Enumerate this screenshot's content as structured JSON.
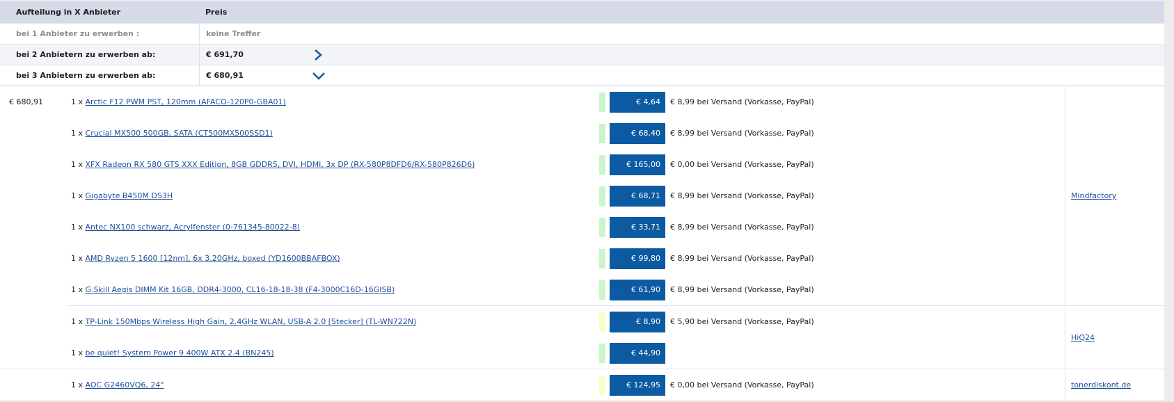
{
  "split": {
    "header": {
      "option": "Aufteilung in X Anbieter",
      "price": "Preis"
    },
    "rows": [
      {
        "label": "bei 1 Anbieter zu erwerben :",
        "price": "keine Treffer"
      },
      {
        "label": "bei 2 Anbietern zu erwerben ab:",
        "price": "€ 691,70",
        "toggle_icon": "chevron-right-icon"
      },
      {
        "label": "bei 3 Anbietern zu erwerben ab:",
        "price": "€ 680,91",
        "toggle_icon": "chevron-down-icon"
      }
    ]
  },
  "detail": {
    "total": "€ 680,91",
    "groups": [
      {
        "vendor": "Mindfactory",
        "items": [
          {
            "qty": "1 x",
            "name": "Arctic F12 PWM PST, 120mm (AFACO-120P0-GBA01)",
            "availability": "green",
            "price": "€ 4,64",
            "shipping": "€ 8,99 bei Versand (Vorkasse, PayPal)"
          },
          {
            "qty": "1 x",
            "name": "Crucial MX500 500GB, SATA (CT500MX500SSD1)",
            "availability": "green",
            "price": "€ 68,40",
            "shipping": "€ 8,99 bei Versand (Vorkasse, PayPal)"
          },
          {
            "qty": "1 x",
            "name": "XFX Radeon RX 580 GTS XXX Edition, 8GB GDDR5, DVI, HDMI, 3x DP (RX-580P8DFD6/RX-580P826D6)",
            "availability": "green",
            "price": "€ 165,00",
            "shipping": "€ 0,00 bei Versand (Vorkasse, PayPal)"
          },
          {
            "qty": "1 x",
            "name": "Gigabyte B450M DS3H",
            "availability": "green",
            "price": "€ 68,71",
            "shipping": "€ 8,99 bei Versand (Vorkasse, PayPal)"
          },
          {
            "qty": "1 x",
            "name": "Antec NX100 schwarz, Acrylfenster (0-761345-80022-8)",
            "availability": "green",
            "price": "€ 33,71",
            "shipping": "€ 8,99 bei Versand (Vorkasse, PayPal)"
          },
          {
            "qty": "1 x",
            "name": "AMD Ryzen 5 1600 [12nm], 6x 3.20GHz, boxed (YD1600BBAFBOX)",
            "availability": "green",
            "price": "€ 99,80",
            "shipping": "€ 8,99 bei Versand (Vorkasse, PayPal)"
          },
          {
            "qty": "1 x",
            "name": "G.Skill Aegis DIMM Kit 16GB, DDR4-3000, CL16-18-18-38 (F4-3000C16D-16GISB)",
            "availability": "green",
            "price": "€ 61,90",
            "shipping": "€ 8,99 bei Versand (Vorkasse, PayPal)"
          }
        ]
      },
      {
        "vendor": "HiQ24",
        "items": [
          {
            "qty": "1 x",
            "name": "TP-Link 150Mbps Wireless High Gain, 2.4GHz WLAN, USB-A 2.0 [Stecker] (TL-WN722N)",
            "availability": "yellow",
            "price": "€ 8,90",
            "shipping": "€ 5,90 bei Versand (Vorkasse, PayPal)"
          },
          {
            "qty": "1 x",
            "name": "be quiet! System Power 9 400W ATX 2.4 (BN245)",
            "availability": "green",
            "price": "€ 44,90"
          }
        ]
      },
      {
        "vendor": "tonerdiskont.de",
        "items": [
          {
            "qty": "1 x",
            "name": "AOC G2460VQ6, 24\"",
            "availability": "yellow",
            "price": "€ 124,95",
            "shipping": "€ 0,00 bei Versand (Vorkasse, PayPal)"
          }
        ]
      }
    ]
  },
  "colors": {
    "header_bg": "#d5d9e8",
    "row_alt_bg": "#f3f4f8",
    "price_box": "#0b5aa2",
    "link": "#1d4f9a",
    "chevron": "#1c5aa3",
    "available_green": "#c9f5c9",
    "available_yellow": "#fbfbcc"
  }
}
